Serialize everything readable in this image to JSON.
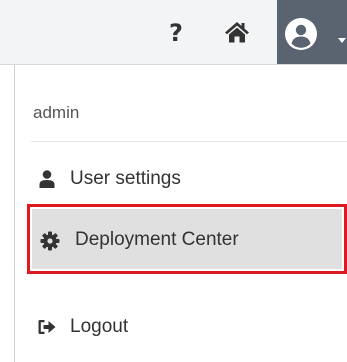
{
  "topbar": {
    "help_icon": "question-icon",
    "help_glyph": "?",
    "home_icon": "home-icon",
    "user_icon": "user-circle-icon",
    "caret_icon": "caret-down-icon",
    "active_toggle_color": "#5a6370"
  },
  "dropdown": {
    "username": "admin",
    "items": [
      {
        "label": "User settings",
        "icon": "user-icon"
      },
      {
        "label": "Deployment Center",
        "icon": "cog-icon",
        "hovered": true
      },
      {
        "label": "Logout",
        "icon": "sign-out-icon"
      }
    ]
  },
  "highlight": {
    "color": "#dd1a22"
  }
}
